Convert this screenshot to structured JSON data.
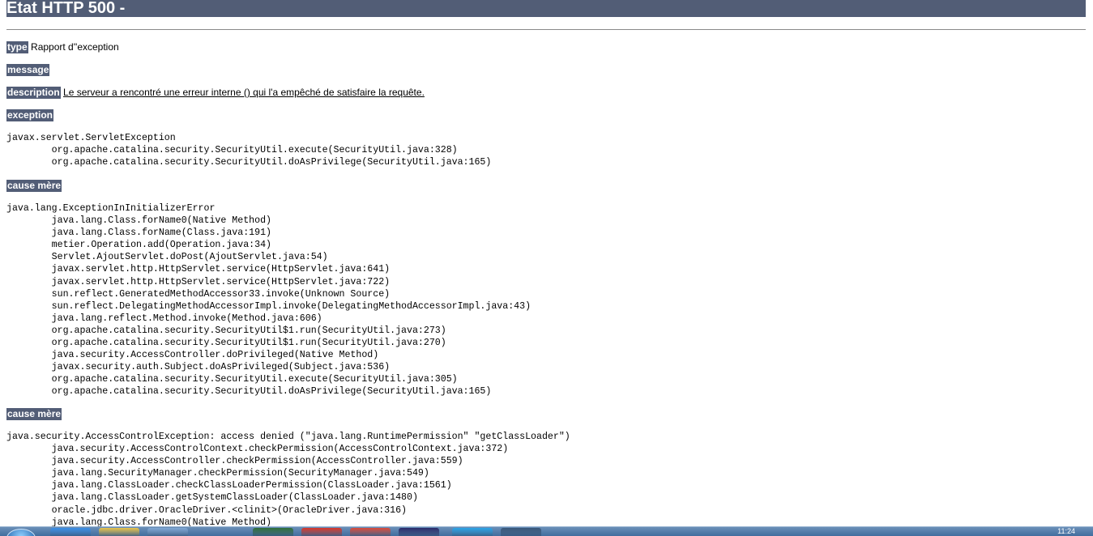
{
  "header": {
    "title": "Etat HTTP 500 -"
  },
  "type_row": {
    "label": "type",
    "value": "Rapport d''exception"
  },
  "message_row": {
    "label": "message"
  },
  "description_row": {
    "label": "description",
    "value": "Le serveur a rencontré une erreur interne () qui l'a empêché de satisfaire la requête."
  },
  "exception_section": {
    "label": "exception",
    "trace": "javax.servlet.ServletException\n\torg.apache.catalina.security.SecurityUtil.execute(SecurityUtil.java:328)\n\torg.apache.catalina.security.SecurityUtil.doAsPrivilege(SecurityUtil.java:165)"
  },
  "cause_1": {
    "label": "cause mère",
    "trace": "java.lang.ExceptionInInitializerError\n\tjava.lang.Class.forName0(Native Method)\n\tjava.lang.Class.forName(Class.java:191)\n\tmetier.Operation.add(Operation.java:34)\n\tServlet.AjoutServlet.doPost(AjoutServlet.java:54)\n\tjavax.servlet.http.HttpServlet.service(HttpServlet.java:641)\n\tjavax.servlet.http.HttpServlet.service(HttpServlet.java:722)\n\tsun.reflect.GeneratedMethodAccessor33.invoke(Unknown Source)\n\tsun.reflect.DelegatingMethodAccessorImpl.invoke(DelegatingMethodAccessorImpl.java:43)\n\tjava.lang.reflect.Method.invoke(Method.java:606)\n\torg.apache.catalina.security.SecurityUtil$1.run(SecurityUtil.java:273)\n\torg.apache.catalina.security.SecurityUtil$1.run(SecurityUtil.java:270)\n\tjava.security.AccessController.doPrivileged(Native Method)\n\tjavax.security.auth.Subject.doAsPrivileged(Subject.java:536)\n\torg.apache.catalina.security.SecurityUtil.execute(SecurityUtil.java:305)\n\torg.apache.catalina.security.SecurityUtil.doAsPrivilege(SecurityUtil.java:165)"
  },
  "cause_2": {
    "label": "cause mère",
    "trace": "java.security.AccessControlException: access denied (\"java.lang.RuntimePermission\" \"getClassLoader\")\n\tjava.security.AccessControlContext.checkPermission(AccessControlContext.java:372)\n\tjava.security.AccessController.checkPermission(AccessController.java:559)\n\tjava.lang.SecurityManager.checkPermission(SecurityManager.java:549)\n\tjava.lang.ClassLoader.checkClassLoaderPermission(ClassLoader.java:1561)\n\tjava.lang.ClassLoader.getSystemClassLoader(ClassLoader.java:1480)\n\toracle.jdbc.driver.OracleDriver.<clinit>(OracleDriver.java:316)\n\tjava.lang.Class.forName0(Native Method)"
  },
  "taskbar": {
    "clock": "11:24",
    "buttons": [
      {
        "icon": "ie-icon",
        "color": "#3a8ee6"
      },
      {
        "icon": "folder-icon",
        "color": "#e8c34a"
      },
      {
        "icon": "monitor-icon",
        "color": "#7fa7d4"
      },
      {
        "icon": "app-icon",
        "color": "#2f6f3a"
      },
      {
        "icon": "opera-icon",
        "color": "#d9362b"
      },
      {
        "icon": "chrome-icon",
        "color": "#d94a3b"
      },
      {
        "icon": "eclipse-icon",
        "color": "#2b2b6b"
      },
      {
        "icon": "skype-icon",
        "color": "#2aa3e6"
      },
      {
        "icon": "window-icon",
        "color": "#39577a"
      }
    ]
  },
  "colors": {
    "header_bg": "#525d76",
    "header_text": "#ffffff"
  }
}
